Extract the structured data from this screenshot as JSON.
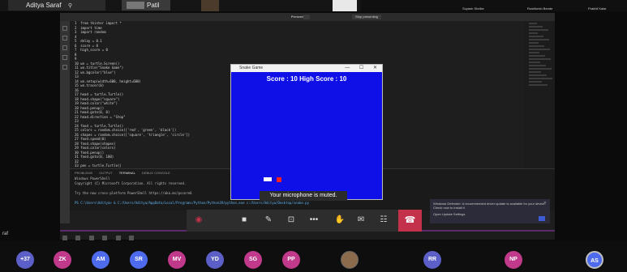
{
  "top_strip": {
    "aditya_name": "Aditya Saraf",
    "patil_name": "Patil",
    "mini_names": [
      "Suyash Shelke",
      "Rushikesh Bende",
      "Prakhil Kalar"
    ]
  },
  "vscode": {
    "title_center": "Presenting",
    "stop_button": "Stop presenting",
    "code_lines": [
      "1  from tkinter import *",
      "2  import time",
      "3  import random",
      "4",
      "5  delay = 0.1",
      "6  score = 0",
      "7  high_score = 0",
      "8",
      "9",
      "10 wn = turtle.Screen()",
      "11 wn.title(\"Snake Game\")",
      "12 wn.bgcolor(\"blue\")",
      "13",
      "14 wn.setup(width=600, height=600)",
      "15 wn.tracer(0)",
      "16",
      "17 head = turtle.Turtle()",
      "18 head.shape(\"square\")",
      "19 head.color(\"white\")",
      "20 head.penup()",
      "21 head.goto(0, 0)",
      "22 head.direction = \"Stop\"",
      "23",
      "24 food = turtle.Turtle()",
      "25 colors = random.choice(['red', 'green', 'black'])",
      "26 shapes = random.choice(['square', 'triangle', 'circle'])",
      "27 food.speed(0)",
      "28 food.shape(shapes)",
      "29 food.color(colors)",
      "30 food.penup()",
      "31 food.goto(0, 100)",
      "32",
      "33 pen = turtle.Turtle()",
      "34 pen.speed(0)"
    ],
    "panel_tabs": [
      "PROBLEMS",
      "OUTPUT",
      "TERMINAL",
      "DEBUG CONSOLE"
    ],
    "terminal_lines": [
      "Windows PowerShell",
      "Copyright (C) Microsoft Corporation. All rights reserved.",
      "",
      "Try the new cross-platform PowerShell https://aka.ms/pscore6",
      ""
    ],
    "terminal_link": "PS C:\\Users\\Aditya> & C:/Users/Aditya/AppData/Local/Programs/Python/Python39/python.exe c:/Users/Aditya/Desktop/snake.py"
  },
  "game": {
    "window_title": "Snake Game",
    "score_text": "Score : 10  High Score : 10",
    "controls": [
      "—",
      "☐",
      "✕"
    ]
  },
  "toast": "Your microphone is muted.",
  "notification": {
    "text": "Windows Defender: A recommended driver update is available for your device. Check now to install it.",
    "link": "Open Update Settings"
  },
  "side_label": "raf",
  "participants": [
    {
      "initials": "+37",
      "color": "#5b5fc7"
    },
    {
      "initials": "ZK",
      "color": "#c0398a"
    },
    {
      "initials": "AM",
      "color": "#4f6bed"
    },
    {
      "initials": "SR",
      "color": "#4f6bed"
    },
    {
      "initials": "MV",
      "color": "#c0398a"
    },
    {
      "initials": "YD",
      "color": "#5b5fc7"
    },
    {
      "initials": "SG",
      "color": "#c0398a"
    },
    {
      "initials": "PP",
      "color": "#c0398a"
    },
    {
      "initials": "RR",
      "color": "#5b5fc7"
    },
    {
      "initials": "NP",
      "color": "#c0398a"
    },
    {
      "initials": "AS",
      "color": "#4f6bed"
    }
  ]
}
